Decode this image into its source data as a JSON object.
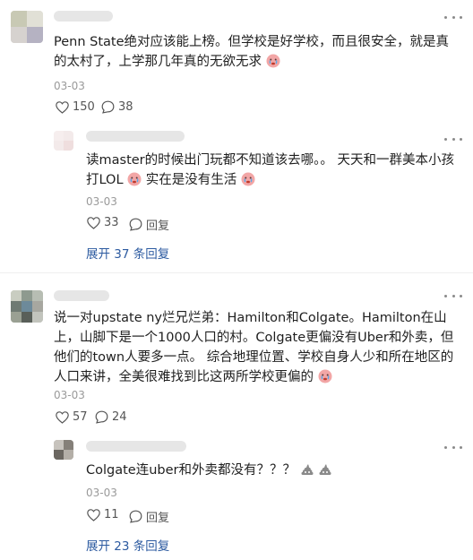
{
  "comments": [
    {
      "text": "Penn State绝对应该能上榜。但学校是好学校，而且很安全，就是真的太村了，上学那几年真的无欲无求",
      "emoji": "crying-face-emoji",
      "date": "03-03",
      "likes": "150",
      "replies_count": "38",
      "reply": {
        "text_a": "读master的时候出门玩都不知道该去哪。。 天天和一群美本小孩打LOL",
        "text_b": "实在是没有生活",
        "date": "03-03",
        "likes": "33",
        "reply_label": "回复"
      },
      "expand_label": "展开 37 条回复"
    },
    {
      "text": "说一对upstate ny烂兄烂弟：Hamilton和Colgate。Hamilton在山上，山脚下是一个1000人口的村。Colgate更偏没有Uber和外卖，但他们的town人要多一点。 综合地理位置、学校自身人少和所在地区的人口来讲，全美很难找到比这两所学校更偏的",
      "date": "03-03",
      "likes": "57",
      "replies_count": "24",
      "reply": {
        "text_a": "Colgate连uber和外卖都没有？？？",
        "date": "03-03",
        "likes": "11",
        "reply_label": "回复"
      },
      "expand_label": "展开 23 条回复"
    }
  ]
}
